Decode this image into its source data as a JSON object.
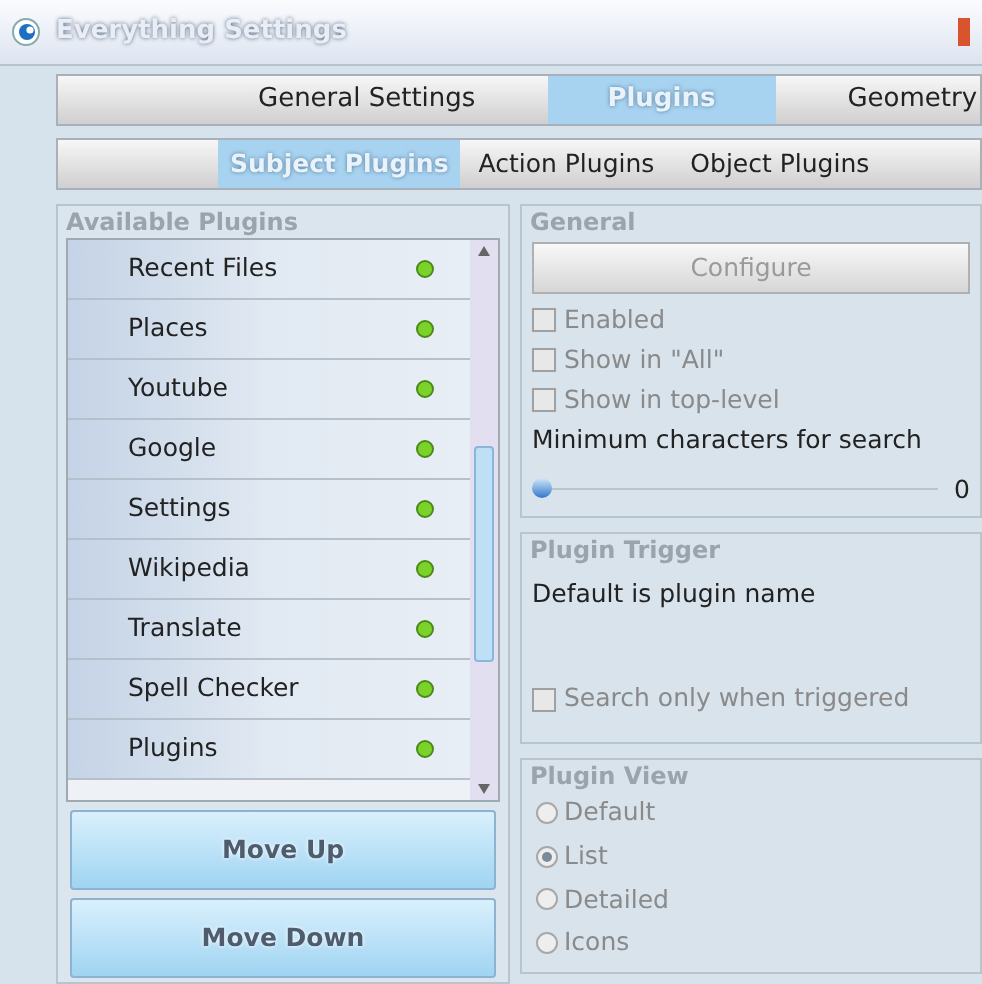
{
  "window": {
    "title": "Everything Settings"
  },
  "tabs": [
    {
      "label": "General Settings",
      "selected": false
    },
    {
      "label": "Plugins",
      "selected": true
    },
    {
      "label": "Geometry",
      "selected": false
    }
  ],
  "subtabs": [
    {
      "label": "Subject Plugins",
      "selected": true
    },
    {
      "label": "Action Plugins",
      "selected": false
    },
    {
      "label": "Object Plugins",
      "selected": false
    }
  ],
  "available_plugins": {
    "title": "Available Plugins",
    "items": [
      {
        "name": "Recent Files",
        "active": true
      },
      {
        "name": "Places",
        "active": true
      },
      {
        "name": "Youtube",
        "active": true
      },
      {
        "name": "Google",
        "active": true
      },
      {
        "name": "Settings",
        "active": true
      },
      {
        "name": "Wikipedia",
        "active": true
      },
      {
        "name": "Translate",
        "active": true
      },
      {
        "name": "Spell Checker",
        "active": true
      },
      {
        "name": "Plugins",
        "active": true
      }
    ],
    "buttons": [
      "Move Up",
      "Move Down"
    ]
  },
  "general": {
    "title": "General",
    "configure": {
      "label": "Configure",
      "disabled": true
    },
    "checkboxes": [
      {
        "label": "Enabled",
        "checked": false,
        "disabled": true
      },
      {
        "label": "Show in \"All\"",
        "checked": false,
        "disabled": true
      },
      {
        "label": "Show in top-level",
        "checked": false,
        "disabled": true
      }
    ],
    "slider": {
      "label": "Minimum characters for search",
      "level": 0,
      "reading": "0"
    }
  },
  "plugin_trigger": {
    "title": "Plugin Trigger",
    "text": "Default is plugin name",
    "checkbox": {
      "label": "Search only when triggered",
      "checked": false,
      "disabled": true
    }
  },
  "plugin_view": {
    "title": "Plugin View",
    "options": [
      {
        "label": "Default",
        "selected": false
      },
      {
        "label": "List",
        "selected": true
      },
      {
        "label": "Detailed",
        "selected": false
      },
      {
        "label": "Icons",
        "selected": false
      }
    ]
  }
}
